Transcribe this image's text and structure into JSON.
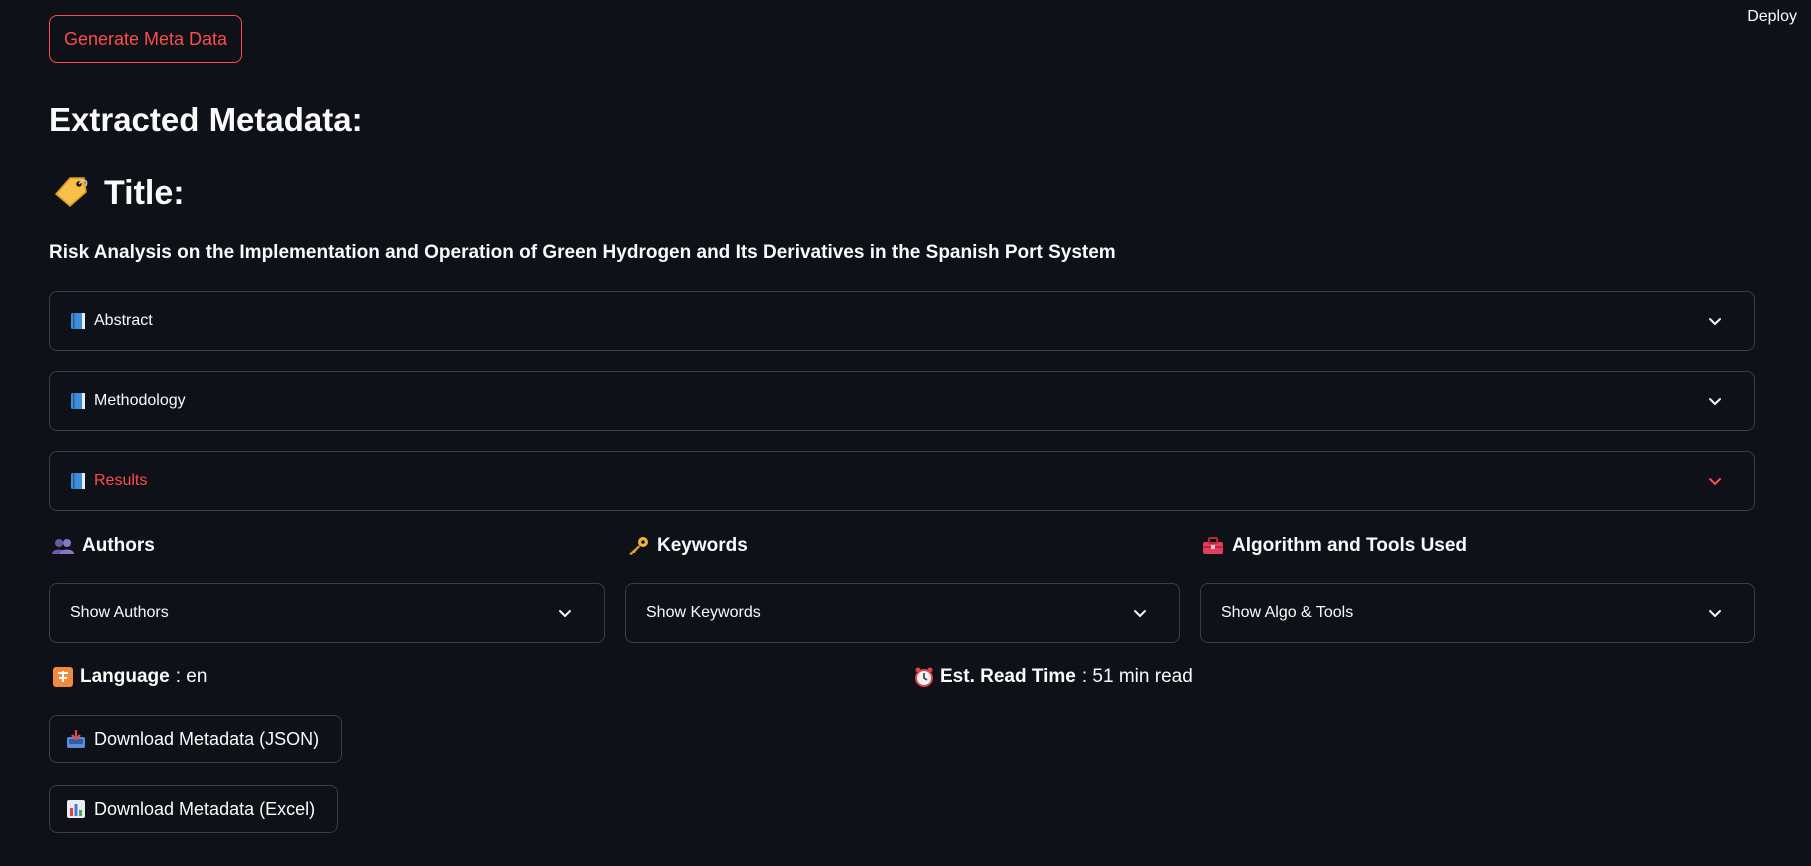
{
  "header": {
    "deploy_label": "Deploy"
  },
  "actions": {
    "generate_label": "Generate Meta Data"
  },
  "main": {
    "heading": "Extracted Metadata:",
    "title_heading": "Title:",
    "paper_title": "Risk Analysis on the Implementation and Operation of Green Hydrogen and Its Derivatives in the Spanish Port System",
    "expanders": [
      {
        "label": "Abstract",
        "icon": "blue-book-icon"
      },
      {
        "label": "Methodology",
        "icon": "blue-book-icon"
      },
      {
        "label": "Results",
        "icon": "blue-book-icon",
        "active": true
      }
    ],
    "columns": [
      {
        "heading": "Authors",
        "icon": "people-icon",
        "select_label": "Show Authors"
      },
      {
        "heading": "Keywords",
        "icon": "key-icon",
        "select_label": "Show Keywords"
      },
      {
        "heading": "Algorithm and Tools Used",
        "icon": "toolbox-icon",
        "select_label": "Show Algo & Tools"
      }
    ],
    "language": {
      "label": "Language",
      "value": ": en",
      "icon": "language-icon"
    },
    "read_time": {
      "label": "Est. Read Time",
      "value": ": 51 min read",
      "icon": "alarm-clock-icon"
    },
    "downloads": [
      {
        "label": "Download Metadata (JSON)",
        "icon": "inbox-tray-icon"
      },
      {
        "label": "Download Metadata (Excel)",
        "icon": "bar-chart-icon"
      }
    ]
  },
  "colors": {
    "background": "#0e1117",
    "accent": "#ff4b4b",
    "border": "#3a3d47",
    "text": "#fafafa"
  }
}
